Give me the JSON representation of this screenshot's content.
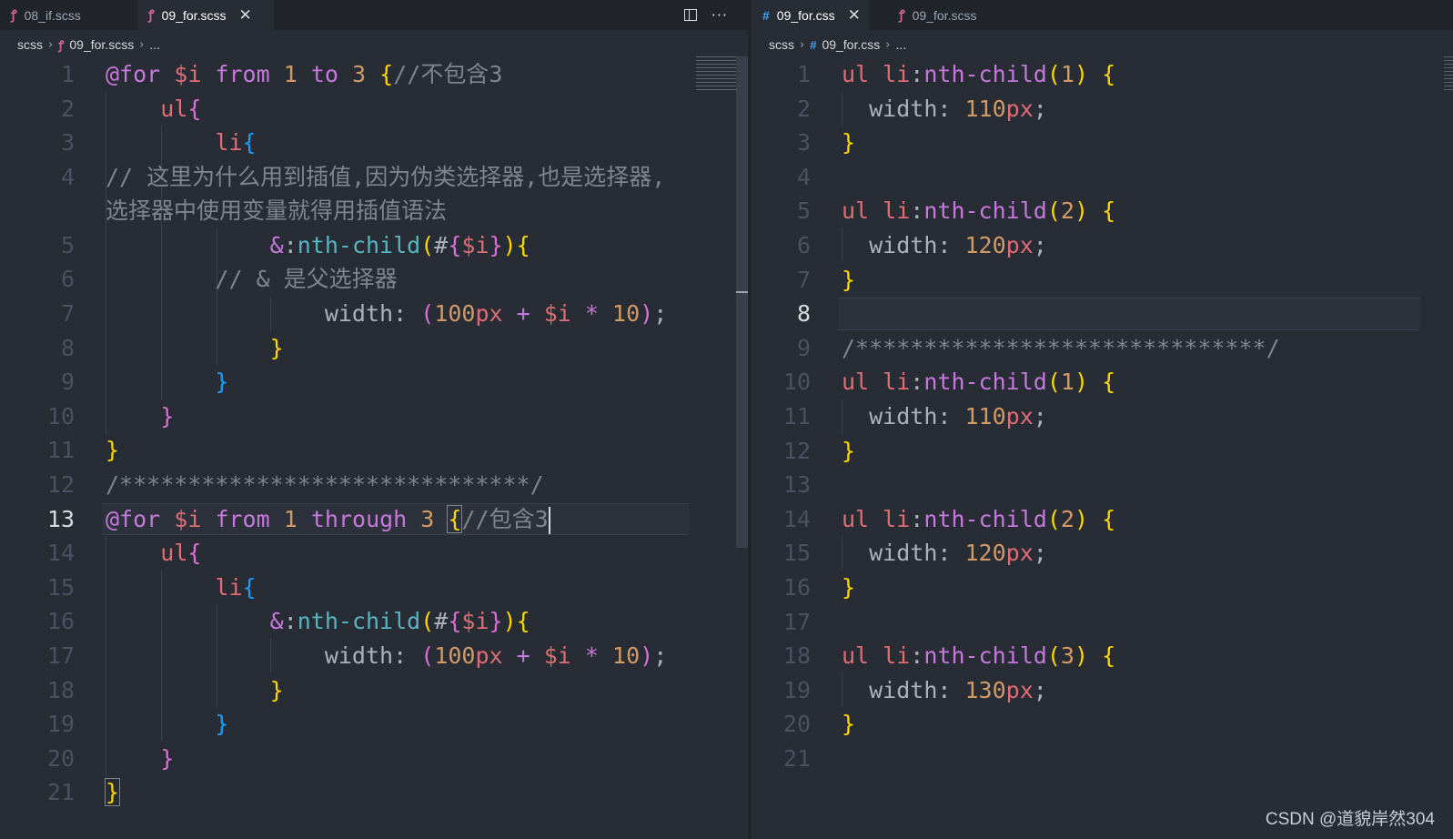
{
  "colors": {
    "background": "#282c34",
    "tabbar": "#21252b",
    "keyword": "#c678dd",
    "variable": "#e06c75",
    "number": "#d19a66",
    "comment": "#7f848e"
  },
  "left": {
    "tabs": [
      {
        "label": "08_if.scss",
        "icon": "sass-file-icon",
        "active": false
      },
      {
        "label": "09_for.scss",
        "icon": "sass-file-icon",
        "active": true
      }
    ],
    "breadcrumb": [
      "scss",
      "09_for.scss",
      "..."
    ],
    "lines": [
      {
        "n": "1"
      },
      {
        "n": "2"
      },
      {
        "n": "3"
      },
      {
        "n": "4"
      },
      {
        "n": "5"
      },
      {
        "n": "6"
      },
      {
        "n": "7"
      },
      {
        "n": "8"
      },
      {
        "n": "9"
      },
      {
        "n": "10"
      },
      {
        "n": "11"
      },
      {
        "n": "12"
      },
      {
        "n": "13"
      },
      {
        "n": "14"
      },
      {
        "n": "15"
      },
      {
        "n": "16"
      },
      {
        "n": "17"
      },
      {
        "n": "18"
      },
      {
        "n": "19"
      },
      {
        "n": "20"
      },
      {
        "n": "21"
      }
    ],
    "code": {
      "l1_from": "from",
      "l1_to": "to",
      "l1_comment": "//不包含3",
      "l4_comment": "// 这里为什么用到插值,因为伪类选择器,也是选择器,选择器中使用变量就得用插值语法",
      "l6_comment": "// & 是父选择器",
      "l12_comment": "/******************************/",
      "l13_through": "through",
      "l13_comment": "//包含3"
    }
  },
  "right": {
    "tabs": [
      {
        "label": "09_for.css",
        "icon": "css-file-icon",
        "active": true
      },
      {
        "label": "09_for.scss",
        "icon": "sass-file-icon",
        "active": false
      }
    ],
    "breadcrumb": [
      "scss",
      "09_for.css",
      "..."
    ],
    "lines": [
      {
        "n": "1"
      },
      {
        "n": "2"
      },
      {
        "n": "3"
      },
      {
        "n": "4"
      },
      {
        "n": "5"
      },
      {
        "n": "6"
      },
      {
        "n": "7"
      },
      {
        "n": "8"
      },
      {
        "n": "9"
      },
      {
        "n": "10"
      },
      {
        "n": "11"
      },
      {
        "n": "12"
      },
      {
        "n": "13"
      },
      {
        "n": "14"
      },
      {
        "n": "15"
      },
      {
        "n": "16"
      },
      {
        "n": "17"
      },
      {
        "n": "18"
      },
      {
        "n": "19"
      },
      {
        "n": "20"
      },
      {
        "n": "21"
      }
    ],
    "comment": "/******************************/",
    "rules": [
      {
        "idx": "1",
        "width": "110"
      },
      {
        "idx": "2",
        "width": "120"
      },
      {
        "idx": "1",
        "width": "110"
      },
      {
        "idx": "2",
        "width": "120"
      },
      {
        "idx": "3",
        "width": "130"
      }
    ]
  },
  "watermark": "CSDN @道貌岸然304"
}
